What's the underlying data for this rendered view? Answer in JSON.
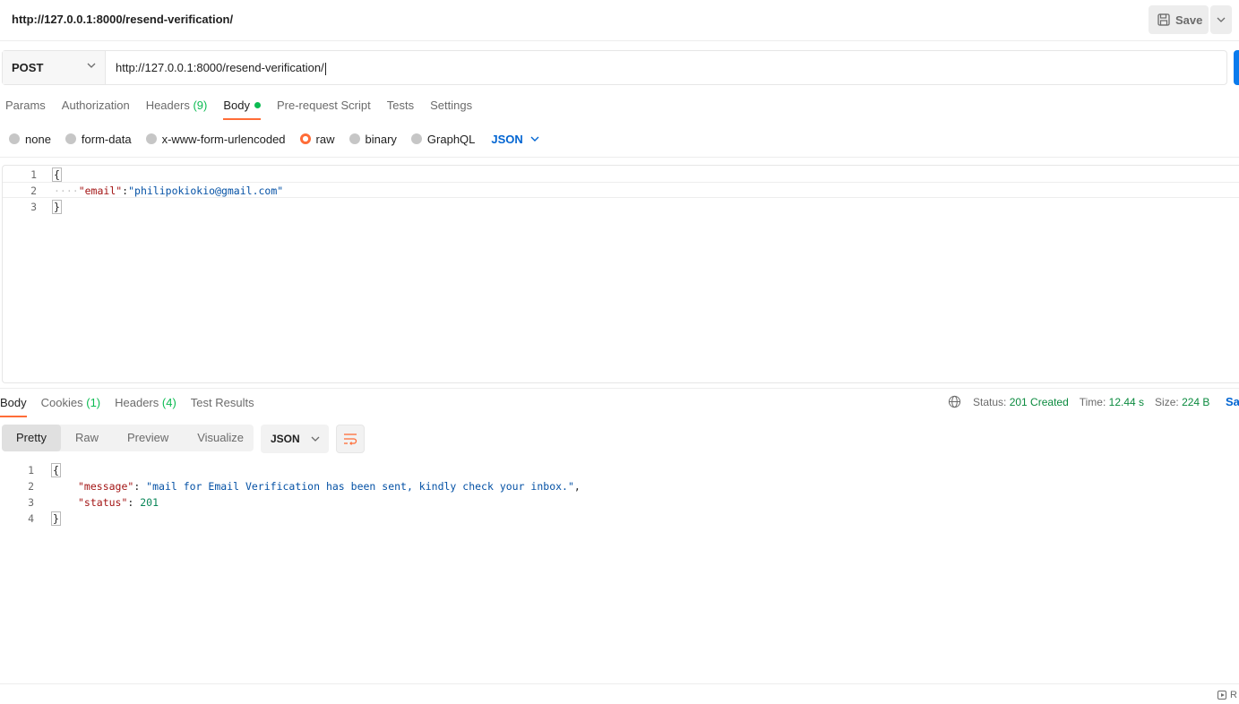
{
  "request": {
    "title": "http://127.0.0.1:8000/resend-verification/",
    "save_label": "Save",
    "method": "POST",
    "url": "http://127.0.0.1:8000/resend-verification/"
  },
  "request_tabs": [
    {
      "label": "Params",
      "count": ""
    },
    {
      "label": "Authorization",
      "count": ""
    },
    {
      "label": "Headers",
      "count": "(9)"
    },
    {
      "label": "Body",
      "count": ""
    },
    {
      "label": "Pre-request Script",
      "count": ""
    },
    {
      "label": "Tests",
      "count": ""
    },
    {
      "label": "Settings",
      "count": ""
    }
  ],
  "body_types": [
    "none",
    "form-data",
    "x-www-form-urlencoded",
    "raw",
    "binary",
    "GraphQL"
  ],
  "body_language": "JSON",
  "request_body": {
    "line_numbers": [
      "1",
      "2",
      "3"
    ],
    "open_brace": "{",
    "key": "\"email\"",
    "colon": ":",
    "value": "\"philipokiokio@gmail.com\"",
    "close_brace": "}",
    "indent_dots": "····"
  },
  "response_tabs": [
    {
      "label": "Body",
      "count": ""
    },
    {
      "label": "Cookies",
      "count": "(1)"
    },
    {
      "label": "Headers",
      "count": "(4)"
    },
    {
      "label": "Test Results",
      "count": ""
    }
  ],
  "response_meta": {
    "status_label": "Status:",
    "status_value": "201 Created",
    "time_label": "Time:",
    "time_value": "12.44 s",
    "size_label": "Size:",
    "size_value": "224 B",
    "save_response": "Sa"
  },
  "response_views": [
    "Pretty",
    "Raw",
    "Preview",
    "Visualize"
  ],
  "response_format": "JSON",
  "response_body": {
    "line_numbers": [
      "1",
      "2",
      "3",
      "4"
    ],
    "open_brace": "{",
    "message_key": "\"message\"",
    "message_value": "\"mail for Email Verification has been sent, kindly check your inbox.\"",
    "status_key": "\"status\"",
    "status_value": "201",
    "close_brace": "}"
  },
  "footer": {
    "runner_label": "R"
  },
  "colors": {
    "accent": "#ff6c37",
    "send_blue": "#097bed",
    "success": "#0cbb52",
    "link": "#0265d2"
  }
}
